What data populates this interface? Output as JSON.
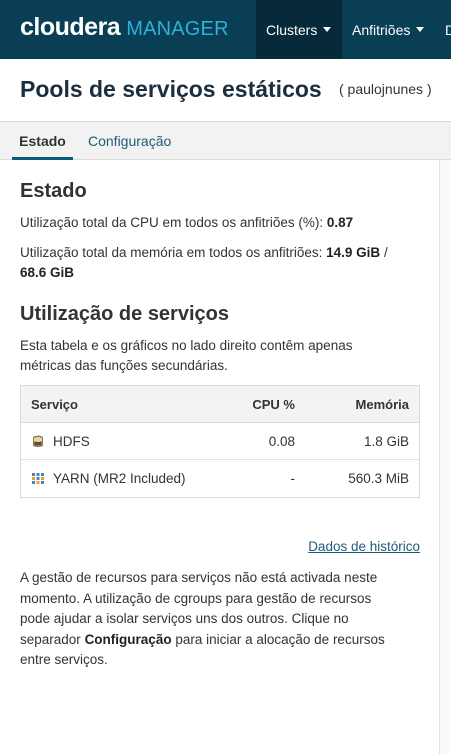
{
  "navbar": {
    "brand_word": "cloudera",
    "brand_sub": "MANAGER",
    "items": [
      {
        "label": "Clusters"
      },
      {
        "label": "Anfitriões"
      },
      {
        "label": "D"
      }
    ]
  },
  "page": {
    "title": "Pools de serviços estáticos",
    "user": "( paulojnunes )"
  },
  "tabs": [
    {
      "label": "Estado",
      "active": true
    },
    {
      "label": "Configuração",
      "active": false
    }
  ],
  "estado": {
    "heading": "Estado",
    "cpu_label": "Utilização total da CPU em todos os anfitriões (%):",
    "cpu_value": "0.87",
    "mem_label": "Utilização total da memória em todos os anfitriões:",
    "mem_used": "14.9 GiB",
    "mem_sep": "/",
    "mem_total": "68.6 GiB"
  },
  "utilizacao": {
    "heading": "Utilização de serviços",
    "desc_line1": "Esta tabela e os gráficos no lado direito contêm apenas",
    "desc_line2": "métricas das funções secundárias.",
    "columns": [
      "Serviço",
      "CPU %",
      "Memória"
    ],
    "rows": [
      {
        "icon": "hdfs-icon",
        "service": "HDFS",
        "cpu": "0.08",
        "memory": "1.8 GiB"
      },
      {
        "icon": "yarn-icon",
        "service": "YARN (MR2 Included)",
        "cpu": "-",
        "memory": "560.3 MiB"
      }
    ]
  },
  "history_link": "Dados de histórico",
  "note": {
    "line1": "A gestão de recursos para serviços não está activada neste",
    "line2": "momento. A utilização de cgroups para gestão de recursos",
    "line3": "pode ajudar a isolar serviços uns dos outros. Clique no",
    "line4_pre": "separador",
    "line4_bold": "Configuração",
    "line4_post": "para iniciar a alocação de recursos",
    "line5": "entre serviços."
  },
  "colors": {
    "navbar": "#0a3e55",
    "navbar_active": "#062a3a",
    "brand_accent": "#2fb0d8",
    "link": "#1f5a7a"
  }
}
